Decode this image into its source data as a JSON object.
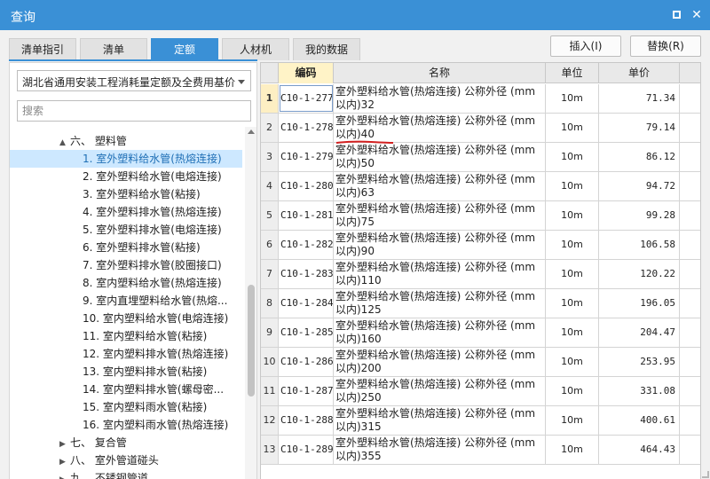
{
  "window": {
    "title": "查询",
    "accent_color": "#3a90d6"
  },
  "tabs": [
    {
      "label": "清单指引",
      "active": false
    },
    {
      "label": "清单",
      "active": false
    },
    {
      "label": "定额",
      "active": true
    },
    {
      "label": "人材机",
      "active": false
    },
    {
      "label": "我的数据",
      "active": false
    }
  ],
  "actions": {
    "insert_label": "插入(I)",
    "replace_label": "替换(R)"
  },
  "left": {
    "library_select": "湖北省通用安装工程消耗量定额及全费用基价表",
    "search_placeholder": "搜索",
    "tree": [
      {
        "label": "六、 塑料管",
        "toggle": "▲",
        "level": 1
      },
      {
        "label": "1. 室外塑料给水管(热熔连接)",
        "level": 2,
        "selected": true
      },
      {
        "label": "2. 室外塑料给水管(电熔连接)",
        "level": 2
      },
      {
        "label": "3. 室外塑料给水管(粘接)",
        "level": 2
      },
      {
        "label": "4. 室外塑料排水管(热熔连接)",
        "level": 2
      },
      {
        "label": "5. 室外塑料排水管(电熔连接)",
        "level": 2
      },
      {
        "label": "6. 室外塑料排水管(粘接)",
        "level": 2
      },
      {
        "label": "7. 室外塑料排水管(胶圈接口)",
        "level": 2
      },
      {
        "label": "8. 室内塑料给水管(热熔连接)",
        "level": 2
      },
      {
        "label": "9. 室内直埋塑料给水管(热熔...",
        "level": 2
      },
      {
        "label": "10. 室内塑料给水管(电熔连接)",
        "level": 2
      },
      {
        "label": "11. 室内塑料给水管(粘接)",
        "level": 2
      },
      {
        "label": "12. 室内塑料排水管(热熔连接)",
        "level": 2
      },
      {
        "label": "13. 室内塑料排水管(粘接)",
        "level": 2
      },
      {
        "label": "14. 室内塑料排水管(螺母密...",
        "level": 2
      },
      {
        "label": "15. 室内塑料雨水管(粘接)",
        "level": 2
      },
      {
        "label": "16. 室内塑料雨水管(热熔连接)",
        "level": 2
      },
      {
        "label": "七、 复合管",
        "toggle": "▶",
        "level": 1
      },
      {
        "label": "八、 室外管道碰头",
        "toggle": "▶",
        "level": 1
      },
      {
        "label": "九、 不锈钢管道",
        "toggle": "▶",
        "level": 1
      }
    ]
  },
  "grid": {
    "headers": {
      "code": "编码",
      "name": "名称",
      "unit": "单位",
      "price": "单价"
    },
    "rows": [
      {
        "no": "1",
        "code": "C10-1-277",
        "name": "室外塑料给水管(热熔连接) 公称外径 (mm以内)32",
        "unit": "10m",
        "price": "71.34"
      },
      {
        "no": "2",
        "code": "C10-1-278",
        "name": "室外塑料给水管(热熔连接) 公称外径 (mm以内)40",
        "unit": "10m",
        "price": "79.14"
      },
      {
        "no": "3",
        "code": "C10-1-279",
        "name": "室外塑料给水管(热熔连接) 公称外径 (mm以内)50",
        "unit": "10m",
        "price": "86.12"
      },
      {
        "no": "4",
        "code": "C10-1-280",
        "name": "室外塑料给水管(热熔连接) 公称外径 (mm以内)63",
        "unit": "10m",
        "price": "94.72"
      },
      {
        "no": "5",
        "code": "C10-1-281",
        "name": "室外塑料给水管(热熔连接) 公称外径 (mm以内)75",
        "unit": "10m",
        "price": "99.28"
      },
      {
        "no": "6",
        "code": "C10-1-282",
        "name": "室外塑料给水管(热熔连接) 公称外径 (mm以内)90",
        "unit": "10m",
        "price": "106.58"
      },
      {
        "no": "7",
        "code": "C10-1-283",
        "name": "室外塑料给水管(热熔连接) 公称外径 (mm以内)110",
        "unit": "10m",
        "price": "120.22"
      },
      {
        "no": "8",
        "code": "C10-1-284",
        "name": "室外塑料给水管(热熔连接) 公称外径 (mm以内)125",
        "unit": "10m",
        "price": "196.05"
      },
      {
        "no": "9",
        "code": "C10-1-285",
        "name": "室外塑料给水管(热熔连接) 公称外径 (mm以内)160",
        "unit": "10m",
        "price": "204.47"
      },
      {
        "no": "10",
        "code": "C10-1-286",
        "name": "室外塑料给水管(热熔连接) 公称外径 (mm以内)200",
        "unit": "10m",
        "price": "253.95"
      },
      {
        "no": "11",
        "code": "C10-1-287",
        "name": "室外塑料给水管(热熔连接) 公称外径 (mm以内)250",
        "unit": "10m",
        "price": "331.08"
      },
      {
        "no": "12",
        "code": "C10-1-288",
        "name": "室外塑料给水管(热熔连接) 公称外径 (mm以内)315",
        "unit": "10m",
        "price": "400.61"
      },
      {
        "no": "13",
        "code": "C10-1-289",
        "name": "室外塑料给水管(热熔连接) 公称外径 (mm以内)355",
        "unit": "10m",
        "price": "464.43"
      }
    ]
  }
}
